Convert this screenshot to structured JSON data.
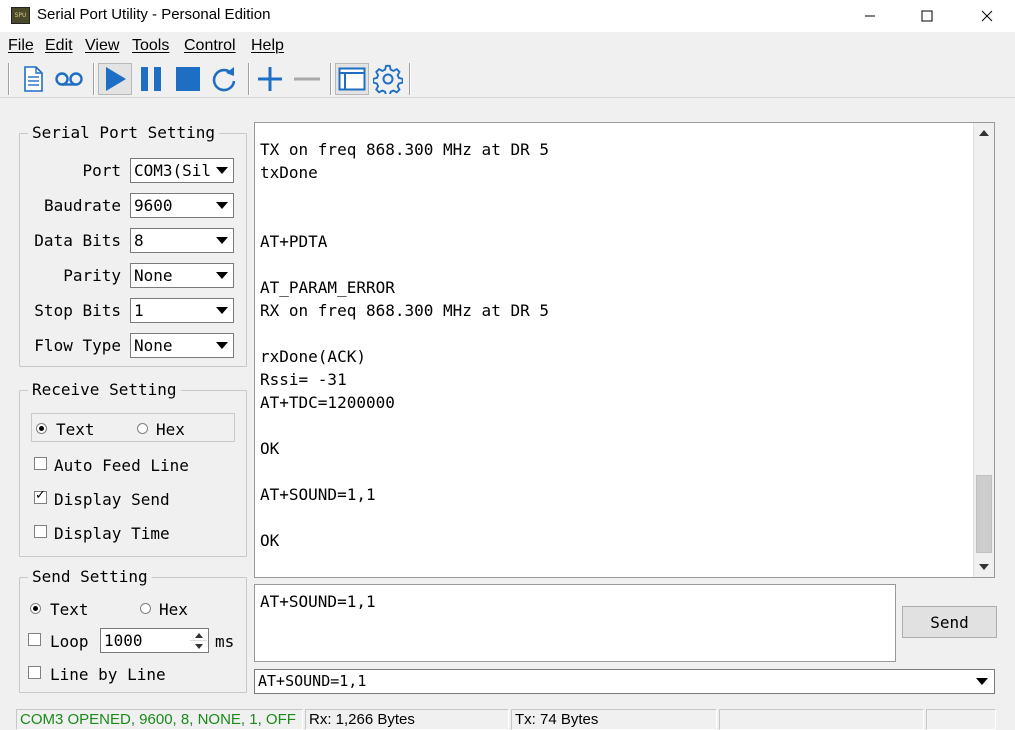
{
  "window": {
    "title": "Serial Port Utility - Personal Edition",
    "icon_text": "SPU",
    "icon_name": "app-icon",
    "controls": [
      "minimize-icon",
      "maximize-icon",
      "close-icon"
    ]
  },
  "menu": {
    "items": [
      {
        "label": "File"
      },
      {
        "label": "Edit"
      },
      {
        "label": "View"
      },
      {
        "label": "Tools"
      },
      {
        "label": "Control"
      },
      {
        "label": "Help"
      }
    ]
  },
  "toolbar": {
    "buttons": [
      {
        "icon": "document-icon"
      },
      {
        "icon": "record-icon"
      },
      {
        "icon": "play-icon"
      },
      {
        "icon": "pause-icon"
      },
      {
        "icon": "stop-icon"
      },
      {
        "icon": "refresh-icon"
      },
      {
        "icon": "plus-icon"
      },
      {
        "icon": "minus-icon"
      },
      {
        "icon": "window-icon"
      },
      {
        "icon": "gear-icon"
      }
    ],
    "accent_color": "#1e6fc4"
  },
  "serial_setting": {
    "title": "Serial Port Setting",
    "port": {
      "label": "Port",
      "value": "COM3(Sil"
    },
    "baudrate": {
      "label": "Baudrate",
      "value": "9600"
    },
    "data_bits": {
      "label": "Data Bits",
      "value": "8"
    },
    "parity": {
      "label": "Parity",
      "value": "None"
    },
    "stop_bits": {
      "label": "Stop Bits",
      "value": "1"
    },
    "flow_type": {
      "label": "Flow Type",
      "value": "None"
    }
  },
  "receive_setting": {
    "title": "Receive Setting",
    "mode_text": "Text",
    "mode_hex": "Hex",
    "selected_mode": "Text",
    "auto_feed_line": {
      "label": "Auto Feed Line",
      "checked": false
    },
    "display_send": {
      "label": "Display Send",
      "checked": true
    },
    "display_time": {
      "label": "Display Time",
      "checked": false
    }
  },
  "send_setting": {
    "title": "Send Setting",
    "mode_text": "Text",
    "mode_hex": "Hex",
    "selected_mode": "Text",
    "loop": {
      "label": "Loop",
      "checked": false,
      "interval": "1000",
      "unit": "ms"
    },
    "line_by_line": {
      "label": "Line by Line",
      "checked": false
    }
  },
  "terminal": {
    "lines": [
      "TX on freq 868.300 MHz at DR 5",
      "txDone",
      "",
      "",
      "AT+PDTA",
      "",
      "AT_PARAM_ERROR",
      "RX on freq 868.300 MHz at DR 5",
      "",
      "rxDone(ACK)",
      "Rssi= -31",
      "AT+TDC=1200000",
      "",
      "OK",
      "",
      "AT+SOUND=1,1",
      "",
      "OK"
    ]
  },
  "send_box": {
    "value": "AT+SOUND=1,1"
  },
  "send_button": {
    "label": "Send"
  },
  "history": {
    "value": "AT+SOUND=1,1"
  },
  "status": {
    "connection": "COM3 OPENED, 9600, 8, NONE, 1, OFF",
    "connection_color": "#1a8a1a",
    "rx": "Rx: 1,266 Bytes",
    "tx": "Tx: 74 Bytes"
  }
}
